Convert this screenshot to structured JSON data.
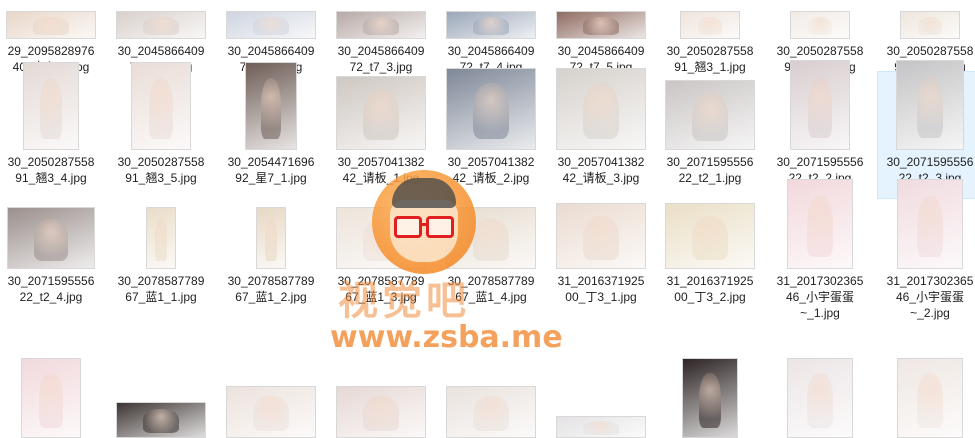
{
  "files": [
    {
      "name_line1": "29_2095828976",
      "name_line2": "40_壳心_4.jpg",
      "color": "#e8d6c8"
    },
    {
      "name_line1": "30_2045866409",
      "name_line2": "72_t7_1.jpg",
      "color": "#d9d0cc"
    },
    {
      "name_line1": "30_2045866409",
      "name_line2": "72_t7_2.jpg",
      "color": "#cfd4e0"
    },
    {
      "name_line1": "30_2045866409",
      "name_line2": "72_t7_3.jpg",
      "color": "#b7a9a6"
    },
    {
      "name_line1": "30_2045866409",
      "name_line2": "72_t7_4.jpg",
      "color": "#9aa6b8"
    },
    {
      "name_line1": "30_2045866409",
      "name_line2": "72_t7_5.jpg",
      "color": "#8f6c62"
    },
    {
      "name_line1": "30_2050287558",
      "name_line2": "91_翘3_1.jpg",
      "color": "#efe4dc"
    },
    {
      "name_line1": "30_2050287558",
      "name_line2": "91_翘3_2.jpg",
      "color": "#f1ebe5"
    },
    {
      "name_line1": "30_2050287558",
      "name_line2": "91_翘3_3.jpg",
      "color": "#ede6dd"
    },
    {
      "name_line1": "30_2050287558",
      "name_line2": "91_翘3_4.jpg",
      "color": "#e4dad6"
    },
    {
      "name_line1": "30_2050287558",
      "name_line2": "91_翘3_5.jpg",
      "color": "#e9ddd8"
    },
    {
      "name_line1": "30_2054471696",
      "name_line2": "92_星7_1.jpg",
      "color": "#6e5d57"
    },
    {
      "name_line1": "30_2057041382",
      "name_line2": "42_请板_1.jpg",
      "color": "#cfc7c1"
    },
    {
      "name_line1": "30_2057041382",
      "name_line2": "42_请板_2.jpg",
      "color": "#7f8898"
    },
    {
      "name_line1": "30_2057041382",
      "name_line2": "42_请板_3.jpg",
      "color": "#d6d1cc"
    },
    {
      "name_line1": "30_2071595556",
      "name_line2": "22_t2_1.jpg",
      "color": "#c9c5c4"
    },
    {
      "name_line1": "30_2071595556",
      "name_line2": "22_t2_2.jpg",
      "color": "#d8cdcf"
    },
    {
      "name_line1": "30_2071595556",
      "name_line2": "22_t2_3.jpg",
      "color": "#c4c4c6"
    },
    {
      "name_line1": "30_2071595556",
      "name_line2": "22_t2_4.jpg",
      "color": "#9a8f8c"
    },
    {
      "name_line1": "30_2078587789",
      "name_line2": "67_蓝1_1.jpg",
      "color": "#e9ddc9"
    },
    {
      "name_line1": "30_2078587789",
      "name_line2": "67_蓝1_2.jpg",
      "color": "#e7d8c4"
    },
    {
      "name_line1": "30_2078587789",
      "name_line2": "67_蓝1_3.jpg",
      "color": "#ede3da"
    },
    {
      "name_line1": "30_2078587789",
      "name_line2": "67_蓝1_4.jpg",
      "color": "#e6dccf"
    },
    {
      "name_line1": "31_2016371925",
      "name_line2": "00_丁3_1.jpg",
      "color": "#eadbd0"
    },
    {
      "name_line1": "31_2016371925",
      "name_line2": "00_丁3_2.jpg",
      "color": "#eadfc6"
    },
    {
      "name_line1": "31_2017302365",
      "name_line2": "46_小宇蛋蛋",
      "name_line3": "~_1.jpg",
      "color": "#f2d8dc"
    },
    {
      "name_line1": "31_2017302365",
      "name_line2": "46_小宇蛋蛋",
      "name_line3": "~_2.jpg",
      "color": "#f0dbe0"
    },
    {
      "name_line1": "",
      "name_line2": "",
      "color": "#f1d9dc"
    },
    {
      "name_line1": "",
      "name_line2": "",
      "color": "#3c3432"
    },
    {
      "name_line1": "",
      "name_line2": "",
      "color": "#ece2dd"
    },
    {
      "name_line1": "",
      "name_line2": "",
      "color": "#e6d8d4"
    },
    {
      "name_line1": "",
      "name_line2": "",
      "color": "#e9e2dd"
    },
    {
      "name_line1": "",
      "name_line2": "",
      "color": "#e4e2e4"
    },
    {
      "name_line1": "",
      "name_line2": "",
      "color": "#2d2424"
    },
    {
      "name_line1": "",
      "name_line2": "",
      "color": "#ece5e6"
    },
    {
      "name_line1": "",
      "name_line2": "",
      "color": "#efe7e3"
    }
  ],
  "selected_file": "30_2071595556 22_t2_3.jpg",
  "watermark": {
    "brand": "视觉吧",
    "url": "www.zsba.me"
  }
}
